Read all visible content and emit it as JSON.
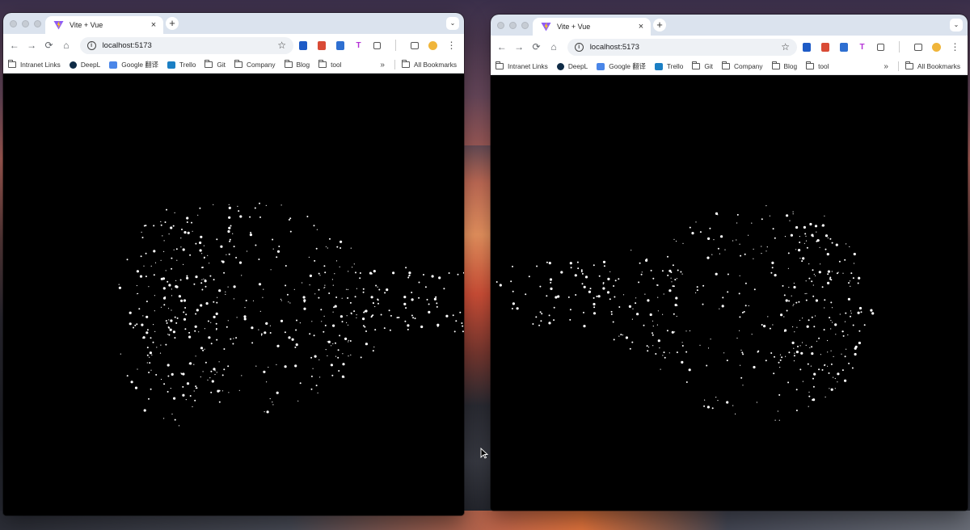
{
  "windows": [
    {
      "tab_title": "Vite + Vue",
      "url": "localhost:5173",
      "bookmarks": [
        "Intranet Links",
        "DeepL",
        "Google 翻译",
        "Trello",
        "Git",
        "Company",
        "Blog",
        "tool"
      ],
      "all_bookmarks_label": "All Bookmarks",
      "more_label": "»"
    },
    {
      "tab_title": "Vite + Vue",
      "url": "localhost:5173",
      "bookmarks": [
        "Intranet Links",
        "DeepL",
        "Google 翻译",
        "Trello",
        "Git",
        "Company",
        "Blog",
        "tool"
      ],
      "all_bookmarks_label": "All Bookmarks",
      "more_label": "»"
    }
  ],
  "colors": {
    "canvas_bg": "#000000",
    "particle": "#ffffff",
    "tab_strip": "#dbe3ee",
    "vite_purple": "#8f5cf7",
    "vite_yellow": "#ffc517"
  },
  "icons": {
    "back": "←",
    "forward": "→",
    "reload": "⟳",
    "home": "⌂",
    "star": "☆",
    "close": "×",
    "plus": "+",
    "chevron": "⌄",
    "menu": "⋮"
  }
}
